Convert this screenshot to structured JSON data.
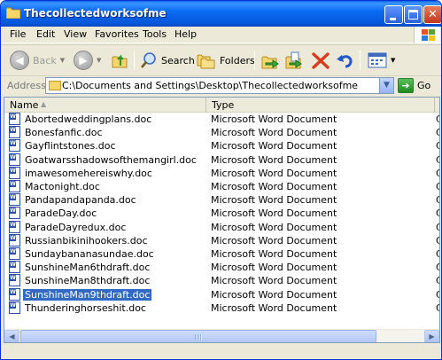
{
  "window": {
    "title": "Thecollectedworksofme"
  },
  "menu": [
    "File",
    "Edit",
    "View",
    "Favorites",
    "Tools",
    "Help"
  ],
  "toolbar": {
    "back_label": "Back",
    "search_label": "Search",
    "folders_label": "Folders"
  },
  "address": {
    "label": "Address",
    "path": "C:\\Documents and Settings\\Desktop\\Thecollectedworksofme",
    "go_label": "Go"
  },
  "columns": {
    "name": "Name",
    "type": "Type",
    "third_partial": "C"
  },
  "files": [
    {
      "name": "Abortedweddingplans.doc",
      "type": "Microsoft Word Document",
      "extra": "C",
      "selected": false
    },
    {
      "name": "Bonesfanfic.doc",
      "type": "Microsoft Word Document",
      "extra": "C",
      "selected": false
    },
    {
      "name": "Gayflintstones.doc",
      "type": "Microsoft Word Document",
      "extra": "C",
      "selected": false
    },
    {
      "name": "Goatwarsshadowsofthemangirl.doc",
      "type": "Microsoft Word Document",
      "extra": "C",
      "selected": false
    },
    {
      "name": "imawesomehereiswhy.doc",
      "type": "Microsoft Word Document",
      "extra": "C",
      "selected": false
    },
    {
      "name": "Mactonight.doc",
      "type": "Microsoft Word Document",
      "extra": "C",
      "selected": false
    },
    {
      "name": "Pandapandapanda.doc",
      "type": "Microsoft Word Document",
      "extra": "C",
      "selected": false
    },
    {
      "name": "ParadeDay.doc",
      "type": "Microsoft Word Document",
      "extra": "C",
      "selected": false
    },
    {
      "name": "ParadeDayredux.doc",
      "type": "Microsoft Word Document",
      "extra": "C",
      "selected": false
    },
    {
      "name": "Russianbikinihookers.doc",
      "type": "Microsoft Word Document",
      "extra": "C",
      "selected": false
    },
    {
      "name": "Sundaybananasundae.doc",
      "type": "Microsoft Word Document",
      "extra": "C",
      "selected": false
    },
    {
      "name": "SunshineMan6thdraft.doc",
      "type": "Microsoft Word Document",
      "extra": "C",
      "selected": false
    },
    {
      "name": "SunshineMan8thdraft.doc",
      "type": "Microsoft Word Document",
      "extra": "C",
      "selected": false
    },
    {
      "name": "SunshineMan9thdraft.doc",
      "type": "Microsoft Word Document",
      "extra": "C",
      "selected": true
    },
    {
      "name": "Thunderinghorseshit.doc",
      "type": "Microsoft Word Document",
      "extra": "C",
      "selected": false
    }
  ]
}
